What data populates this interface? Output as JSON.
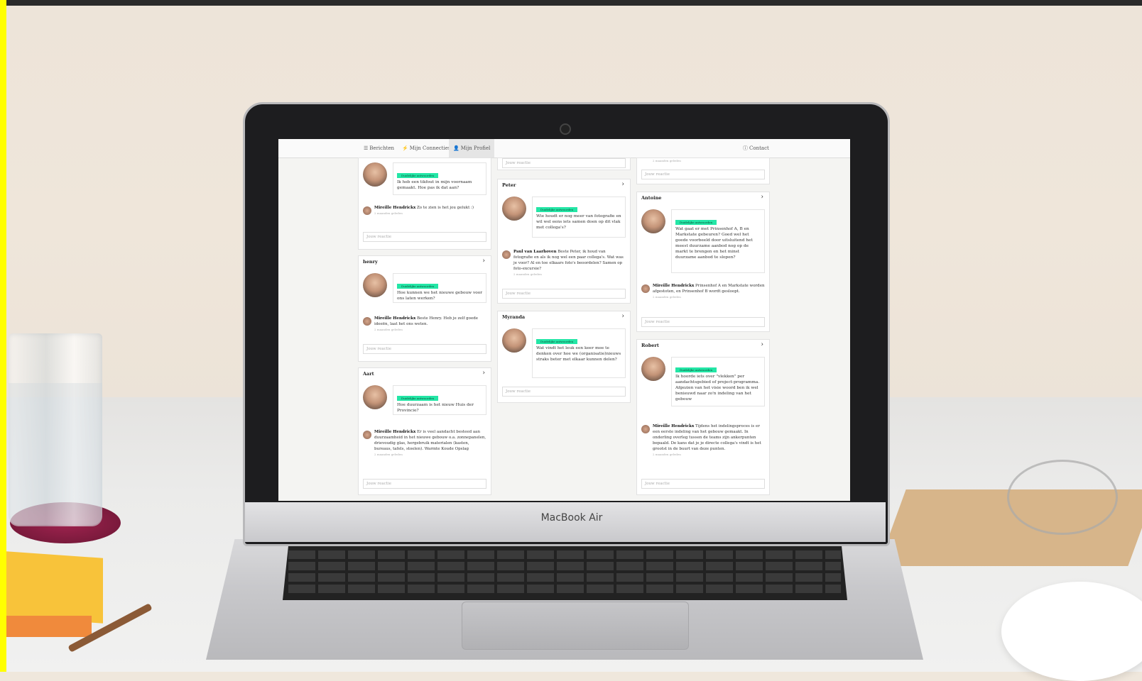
{
  "laptop_brand": "MacBook Air",
  "nav": {
    "berichten": "Berichten",
    "connecties": "Mijn Connecties",
    "profiel": "Mijn Profiel",
    "contact": "Contact"
  },
  "accent_color": "#23e6a6",
  "tag_label": "Duidelijke antwoorden",
  "input_placeholder": "Jouw reactie",
  "stamp": "2 maanden geleden",
  "col1": {
    "card1": {
      "question": "Ik heb een tikfout in mijn voornaam gemaakt. Hoe pas ik dat aan?",
      "reply_name": "Mireille Hendrickx",
      "reply_text": "Zo te zien is het jou gelukt :)"
    },
    "card2": {
      "name": "henry",
      "question": "Hoe kunnen we het nieuwe gebouw voor ons laten werken?",
      "reply_name": "Mireille Hendrickx",
      "reply_text": "Beste Henry. Heb je zelf goede ideeën, laat het ons weten."
    },
    "card3": {
      "name": "Aart",
      "question": "Hoe duurzaam is het nieuw Huis der Provincie?",
      "reply_name": "Mireille Hendrickx",
      "reply_text": "Er is veel aandacht besteed aan duurzaamheid in het nieuwe gebouw o.a. zonnepanelen, drievoudig glas, hergebruik materialen (kasten, bureaus, tafels, stoelen). Warmte Koude Opslag"
    }
  },
  "col2": {
    "card1": {
      "name": "Peter",
      "question": "Wie houdt er nog meer van fotografie en wil wel eens iets samen doen op dit vlak met collega's?",
      "reply_name": "Paul van Laarhoven",
      "reply_text": "Beste Peter, ik houd van fotografie en als ik nog wel een paar collega's. Wat was je voor? Al en toe elkaars foto's beoordelen? Samen op foto-excursie?"
    },
    "card2": {
      "name": "Myranda",
      "question": "Wat vindt het leuk een keer mee te denken over hoe we (organisatie)nieuws straks beter met elkaar kunnen delen?"
    }
  },
  "col3": {
    "card1": {
      "name": "Antoine",
      "question": "Wat gaat er met Prinsenhof A, B en Markstate gebeuren? Goed wel het goede voorbeeld door uitsluitend het meest duurzame aanbod nog op de markt te brengen en het minst duurzame aanbod te slopen?",
      "reply_name": "Mireille Hendrickx",
      "reply_text": "Prinsenhof A en Markstate worden afgestoten, en Prinsenhof B wordt gesloopt."
    },
    "card2": {
      "name": "Robert",
      "question": "Ik hoorde iets over \"vlekken\" per aandachtsgebied of project-programma. Afgezien van het visie woord ben ik wel benieuwd naar zo'n indeling van het gebouw",
      "reply_name": "Mireille Hendrickx",
      "reply_text": "Tijdens het indelingsproces is er een eerste indeling van het gebouw gemaakt. In onderling overleg tussen de teams zijn ankerpunten bepaald. De kans dat je je directe collega's vindt is het grootst in de buurt van deze punten."
    }
  }
}
